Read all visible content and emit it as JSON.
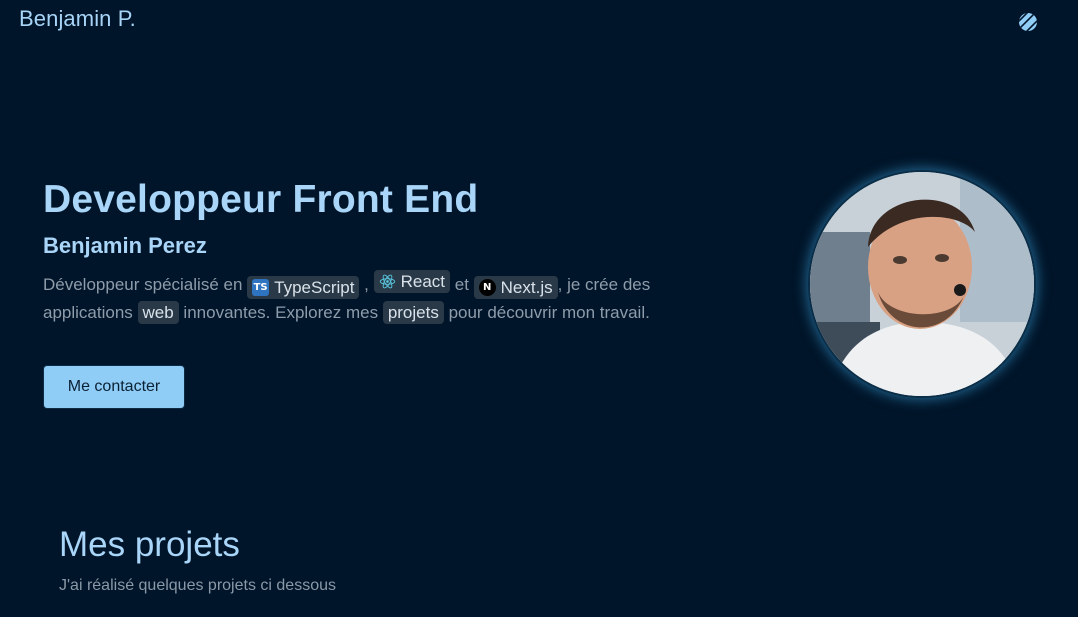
{
  "header": {
    "brand": "Benjamin P.",
    "theme_toggle_icon": "theme-toggle-icon"
  },
  "hero": {
    "title": "Developpeur Front End",
    "name": "Benjamin Perez",
    "desc_part1": "Développeur spécialisé en ",
    "chip_typescript": "TypeScript",
    "sep1": " , ",
    "chip_react": "React",
    "sep2": " et ",
    "chip_next": "Next.js",
    "desc_part2": ", je crée des applications ",
    "chip_web": "web",
    "desc_part3": " innovantes. Explorez mes ",
    "chip_projets": "projets",
    "desc_part4": " pour découvrir mon travail.",
    "ts_badge": "TS",
    "next_badge": "N",
    "contact_label": "Me contacter"
  },
  "projects": {
    "title": "Mes projets",
    "subtitle": "J'ai réalisé quelques projets ci dessous"
  },
  "colors": {
    "background": "#001529",
    "accent": "#a9d5f8",
    "button": "#8fccf6"
  }
}
